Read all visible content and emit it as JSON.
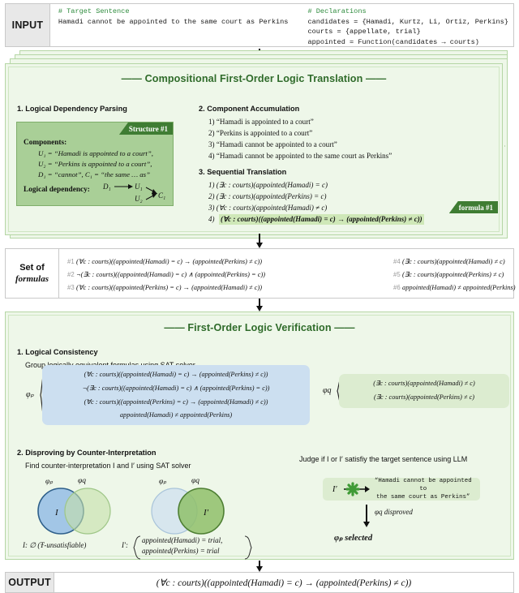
{
  "io": {
    "input_label": "INPUT",
    "output_label": "OUTPUT",
    "target_comment": "# Target Sentence",
    "target_sentence": "Hamadi cannot be appointed to the same court as Perkins",
    "decl_comment": "# Declarations",
    "decl_1": "candidates = {Hamadi, Kurtz, Li, Ortiz, Perkins}",
    "decl_2": "courts = {appellate, trial}",
    "decl_3": "appointed = Function(candidates → courts)",
    "output_formula": "(∀c : courts)((appointed(Hamadi) = c) → (appointed(Perkins) ≠ c))"
  },
  "translation": {
    "title": "—— Compositional First-Order Logic Translation ——",
    "step1_head": "1. Logical Dependency Parsing",
    "structure_tag": "Structure #1",
    "components_label": "Components:",
    "components": [
      "U₁ = “Hamadi is appointed to a court”,",
      "U₂ = “Perkins is appointed to a court”,",
      "D₁ = “cannot”,    C₁ = “the same … as”"
    ],
    "dependency_label": "Logical dependency:",
    "dep_nodes": {
      "d1": "D₁",
      "u1": "U₁",
      "u2": "U₂",
      "c1": "C₁"
    },
    "step2_head": "2. Component Accumulation",
    "accumulation": [
      "1) “Hamadi is appointed to a court”",
      "2) “Perkins is appointed to a court”",
      "3) “Hamadi cannot be appointed to a court”",
      "4) “Hamadi cannot be appointed to the same court as Perkins”"
    ],
    "step3_head": "3. Sequential Translation",
    "sequential": [
      "1) (∃c : courts)(appointed(Hamadi) = c)",
      "2) (∃c : courts)(appointed(Perkins) = c)",
      "3) (∀c : courts)(appointed(Hamadi) ≠ c)"
    ],
    "sequential_final_index": "4)",
    "sequential_final": "(∀c : courts)((appointed(Hamadi) = c) → (appointed(Perkins) ≠ c))",
    "formula_tag": "formula #1"
  },
  "set_of_formulas": {
    "label_line1": "Set of",
    "label_line2": "formulas",
    "items": [
      {
        "idx": "#1",
        "text": "(∀c : courts)((appointed(Hamadi) = c) → (appointed(Perkins) ≠ c))"
      },
      {
        "idx": "#2",
        "text": "¬(∃c : courts)((appointed(Hamadi) = c) ∧ (appointed(Perkins) = c))"
      },
      {
        "idx": "#3",
        "text": "(∀c : courts)((appointed(Perkins) = c) → (appointed(Hamadi) ≠ c))"
      },
      {
        "idx": "#4",
        "text": "(∃c : courts)(appointed(Hamadi) ≠ c)"
      },
      {
        "idx": "#5",
        "text": "(∃c : courts)(appointed(Perkins) ≠ c)"
      },
      {
        "idx": "#6",
        "text": "appointed(Hamadi) ≠ appointed(Perkins)"
      }
    ]
  },
  "verification": {
    "title": "—— First-Order Logic Verification ——",
    "step1_head": "1. Logical Consistency",
    "step1_sub": "Group logically equivalent formulas using SAT solver",
    "phi_p_label": "φₚ",
    "phi_q_label": "φq",
    "phi_p_group": [
      "(∀c : courts)((appointed(Hamadi) = c) → (appointed(Perkins) ≠ c))",
      "¬(∃c : courts)((appointed(Hamadi) = c) ∧ (appointed(Perkins) = c))",
      "(∀c : courts)((appointed(Perkins) = c) → (appointed(Hamadi) ≠ c))",
      "appointed(Hamadi) ≠ appointed(Perkins)"
    ],
    "phi_q_group": [
      "(∃c : courts)(appointed(Hamadi) ≠ c)",
      "(∃c : courts)(appointed(Perkins) ≠ c)"
    ],
    "step2_head": "2. Disproving by Counter-Interpretation",
    "step2_sub": "Find counter-interpretation I and I′ using SAT solver",
    "venn_left": {
      "left_label": "φₚ",
      "right_label": "φq",
      "inner_label": "I"
    },
    "venn_right": {
      "left_label": "φₚ",
      "right_label": "φq",
      "inner_label": "I′"
    },
    "caption_left": "I: ∅  (Ŧ-unsatisfiable)",
    "caption_right_key": "I′:",
    "caption_right_line1": "appointed(Hamadi) = trial,",
    "caption_right_line2": "appointed(Perkins) = trial",
    "judge_head": "Judge if I or I′ satisfiy the target sentence using LLM",
    "judge_subject": "I′",
    "judge_cross_icon": "cross-icon",
    "judge_sentence_line1": "“Hamadi cannot be appointed to",
    "judge_sentence_line2": "the same court as Perkins”",
    "disproved_text": "φq disproved",
    "selected_text": "φₚ selected"
  },
  "colors": {
    "panel_bg": "#eef7e9",
    "panel_border": "#b5d6a5",
    "title_green": "#2f6b2a",
    "structure_bg": "#a9cf97",
    "ribbon_green": "#3f7d33",
    "highlight_green": "#cfe8b8",
    "phi_p_blue": "#ccdff0",
    "phi_q_green": "#dcecd0",
    "venn_blue_fill": "#9dc3e6",
    "venn_blue_stroke": "#2e5f8a",
    "venn_green_fill": "#c5dfa8",
    "venn_green_stroke": "#6e9e4f",
    "comment_green": "#2e8b3d"
  }
}
